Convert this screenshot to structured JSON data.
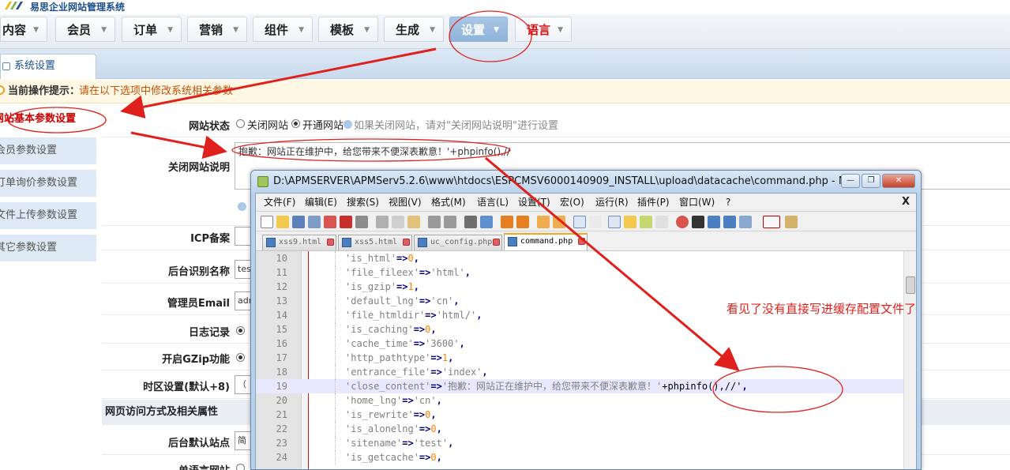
{
  "app": {
    "logo_text": "易思企业网站管理系统"
  },
  "nav": {
    "tabs": [
      {
        "label": "内容"
      },
      {
        "label": "会员"
      },
      {
        "label": "订单"
      },
      {
        "label": "营销"
      },
      {
        "label": "组件"
      },
      {
        "label": "模板"
      },
      {
        "label": "生成"
      },
      {
        "label": "设置"
      },
      {
        "label": "语言"
      }
    ],
    "arrow": "▼"
  },
  "subtab": {
    "label": "系统设置"
  },
  "tips": {
    "label": "当前操作提示：",
    "text": "请在以下选项中修改系统相关参数"
  },
  "sidebar": {
    "items": [
      {
        "label": "网站基本参数设置"
      },
      {
        "label": "会员参数设置"
      },
      {
        "label": "订单询价参数设置"
      },
      {
        "label": "文件上传参数设置"
      },
      {
        "label": "其它参数设置"
      }
    ]
  },
  "form": {
    "site_status": {
      "label": "网站状态",
      "option_closed": "关闭网站",
      "option_open": "开通网站",
      "selected": "open",
      "hint": "如果关闭网站，请对\"关闭网站说明\"进行设置"
    },
    "close_notice": {
      "label": "关闭网站说明",
      "value": "抱歉：网站正在维护中，给您带来不便深表歉意！'+phpinfo(),//"
    },
    "icp": {
      "label": "ICP备案"
    },
    "admin_name": {
      "label": "后台识别名称",
      "value": "tes"
    },
    "admin_email": {
      "label": "管理员Email",
      "value": "adm"
    },
    "log": {
      "label": "日志记录"
    },
    "gzip": {
      "label": "开启GZip功能"
    },
    "timezone": {
      "label": "时区设置(默认+8)",
      "value": "（"
    },
    "section_title": "网页访问方式及相关属性",
    "default_site": {
      "label": "后台默认站点",
      "value": "简"
    },
    "single_lang": {
      "label": "单语言网站"
    }
  },
  "notepad": {
    "title": "D:\\APMSERVER\\APMServ5.2.6\\www\\htdocs\\ESPCMSV6000140909_INSTALL\\upload\\datacache\\command.php - Notepad...",
    "window_buttons": {
      "minimize": "—",
      "restore": "❐",
      "close": "✕"
    },
    "menu": [
      "文件(F)",
      "编辑(E)",
      "搜索(S)",
      "视图(V)",
      "格式(M)",
      "语言(L)",
      "设置(T)",
      "宏(O)",
      "运行(R)",
      "插件(P)",
      "窗口(W)",
      "?"
    ],
    "menu_close": "X",
    "tabs": [
      {
        "name": "xss9.html"
      },
      {
        "name": "xss5.html"
      },
      {
        "name": "uc_config.php"
      },
      {
        "name": "command.php"
      }
    ],
    "active_tab": 3,
    "highlighted_line": 19,
    "lines": [
      {
        "n": "10",
        "key": "'is_html'",
        "op": "=>",
        "val": "0",
        "vtype": "num"
      },
      {
        "n": "11",
        "key": "'file_fileex'",
        "op": "=>",
        "val": "'html'",
        "vtype": "str"
      },
      {
        "n": "12",
        "key": "'is_gzip'",
        "op": "=>",
        "val": "1",
        "vtype": "num"
      },
      {
        "n": "13",
        "key": "'default_lng'",
        "op": "=>",
        "val": "'cn'",
        "vtype": "str"
      },
      {
        "n": "14",
        "key": "'file_htmldir'",
        "op": "=>",
        "val": "'html/'",
        "vtype": "str"
      },
      {
        "n": "15",
        "key": "'is_caching'",
        "op": "=>",
        "val": "0",
        "vtype": "num"
      },
      {
        "n": "16",
        "key": "'cache_time'",
        "op": "=>",
        "val": "'3600'",
        "vtype": "str"
      },
      {
        "n": "17",
        "key": "'http_pathtype'",
        "op": "=>",
        "val": "1",
        "vtype": "num"
      },
      {
        "n": "18",
        "key": "'entrance_file'",
        "op": "=>",
        "val": "'index'",
        "vtype": "str"
      },
      {
        "n": "19",
        "key": "'close_content'",
        "op": "=>",
        "val": "'抱歉：网站正在维护中，给您带来不便深表歉意！'",
        "vtype": "str",
        "extra": "+phpinfo(),//'"
      },
      {
        "n": "20",
        "key": "'home_lng'",
        "op": "=>",
        "val": "'cn'",
        "vtype": "str"
      },
      {
        "n": "21",
        "key": "'is_rewrite'",
        "op": "=>",
        "val": "0",
        "vtype": "num"
      },
      {
        "n": "22",
        "key": "'is_alonelng'",
        "op": "=>",
        "val": "0",
        "vtype": "num"
      },
      {
        "n": "23",
        "key": "'sitename'",
        "op": "=>",
        "val": "'test'",
        "vtype": "str"
      },
      {
        "n": "24",
        "key": "'is_getcache'",
        "op": "=>",
        "val": "0",
        "vtype": "num"
      }
    ]
  },
  "annotation": {
    "text": "看见了没有直接写进缓存配置文件了",
    "color": "#e0201c"
  }
}
